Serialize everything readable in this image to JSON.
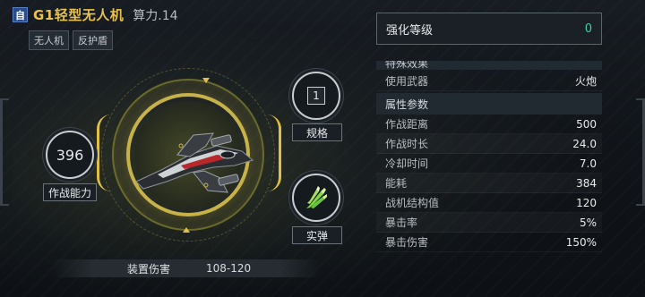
{
  "header": {
    "badge": "自",
    "title": "G1轻型无人机",
    "power_text": "算力.14",
    "tags": [
      "无人机",
      "反护盾"
    ]
  },
  "display": {
    "combat_power_value": "396",
    "combat_power_label": "作战能力",
    "spec_value": "1",
    "spec_label": "规格",
    "ammo_label": "实弹",
    "damage_label": "装置伤害",
    "damage_value": "108-120"
  },
  "panel": {
    "level_label": "强化等级",
    "level_value": "0",
    "cut_section_label": "特殊效果",
    "weapon_row": {
      "label": "使用武器",
      "value": "火炮"
    },
    "attr_section_label": "属性参数",
    "attributes": [
      {
        "label": "作战距离",
        "value": "500"
      },
      {
        "label": "作战时长",
        "value": "24.0"
      },
      {
        "label": "冷却时间",
        "value": "7.0"
      },
      {
        "label": "能耗",
        "value": "384"
      },
      {
        "label": "战机结构值",
        "value": "120"
      },
      {
        "label": "暴击率",
        "value": "5%"
      },
      {
        "label": "暴击伤害",
        "value": "150%"
      }
    ]
  },
  "colors": {
    "title_gold": "#e7c24e",
    "level_green": "#3ed0a0",
    "ring_gold": "#c7b24a",
    "badge_blue": "#2a4c8c"
  }
}
